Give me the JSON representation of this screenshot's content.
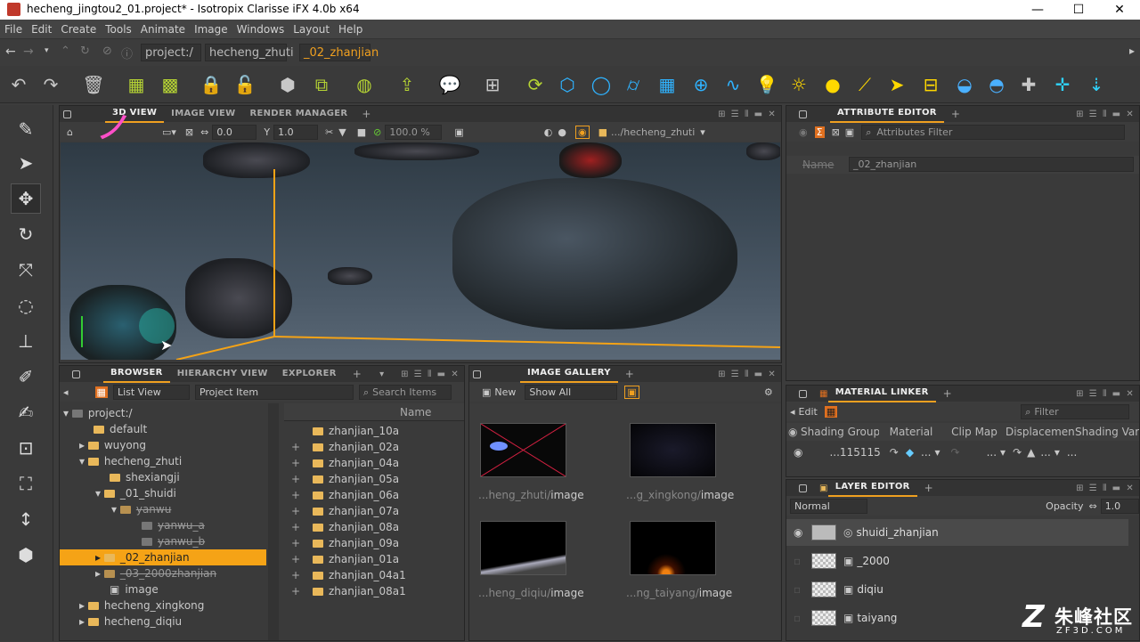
{
  "window": {
    "title": "hecheng_jingtou2_01.project* - Isotropix Clarisse iFX 4.0b x64"
  },
  "menu": [
    "File",
    "Edit",
    "Create",
    "Tools",
    "Animate",
    "Image",
    "Windows",
    "Layout",
    "Help"
  ],
  "path": {
    "root": "project:/",
    "crumb1": "hecheng_zhuti",
    "crumb2": "_02_zhanjian"
  },
  "viewport": {
    "tabs": [
      "3D VIEW",
      "IMAGE VIEW",
      "RENDER MANAGER"
    ],
    "zoom1": "0.0",
    "zoom2": "1.0",
    "percent": "100.0 %",
    "path": ".../hecheng_zhuti"
  },
  "attribute_editor": {
    "tab": "ATTRIBUTE EDITOR",
    "filter_placeholder": "Attributes Filter",
    "name_label": "Name",
    "name_value": "_02_zhanjian"
  },
  "browser": {
    "tabs": [
      "BROWSER",
      "HIERARCHY VIEW",
      "EXPLORER"
    ],
    "list_view": "List View",
    "project_item": "Project Item",
    "search_placeholder": "Search Items",
    "tree": [
      {
        "label": "project:/"
      },
      {
        "label": "default"
      },
      {
        "label": "wuyong"
      },
      {
        "label": "hecheng_zhuti"
      },
      {
        "label": "shexiangji"
      },
      {
        "label": "_01_shuidi"
      },
      {
        "label": "yanwu"
      },
      {
        "label": "yanwu_a"
      },
      {
        "label": "yanwu_b"
      },
      {
        "label": "_02_zhanjian"
      },
      {
        "label": "_03_2000zhanjian"
      },
      {
        "label": "image"
      },
      {
        "label": "hecheng_xingkong"
      },
      {
        "label": "hecheng_diqiu"
      }
    ],
    "name_header": "Name",
    "items": [
      "zhanjian_10a",
      "zhanjian_02a",
      "zhanjian_04a",
      "zhanjian_05a",
      "zhanjian_06a",
      "zhanjian_07a",
      "zhanjian_08a",
      "zhanjian_09a",
      "zhanjian_01a",
      "zhanjian_04a1",
      "zhanjian_08a1"
    ]
  },
  "gallery": {
    "tab": "IMAGE GALLERY",
    "new_label": "New",
    "show_all": "Show All",
    "thumbs": [
      {
        "prefix": "...heng_zhuti/",
        "name": "image"
      },
      {
        "prefix": "...g_xingkong/",
        "name": "image"
      },
      {
        "prefix": "...heng_diqiu/",
        "name": "image"
      },
      {
        "prefix": "...ng_taiyang/",
        "name": "image"
      }
    ]
  },
  "material_linker": {
    "tab": "MATERIAL LINKER",
    "edit_label": "Edit",
    "filter_placeholder": "Filter",
    "columns": [
      "Shading Group",
      "Material",
      "Clip Map",
      "Displacement",
      "Shading Variab"
    ],
    "row_value": "...115115",
    "dots": "..."
  },
  "layer_editor": {
    "tab": "LAYER EDITOR",
    "blend": "Normal",
    "opacity_label": "Opacity",
    "opacity_value": "1.0",
    "layers": [
      "shuidi_zhanjian",
      "_2000",
      "diqiu",
      "taiyang"
    ]
  },
  "watermark": {
    "text": "朱峰社区",
    "url": "ZF3D.COM"
  },
  "colors": {
    "accent": "#f0a020",
    "folder": "#e9b85a",
    "selection": "#f5a316"
  }
}
